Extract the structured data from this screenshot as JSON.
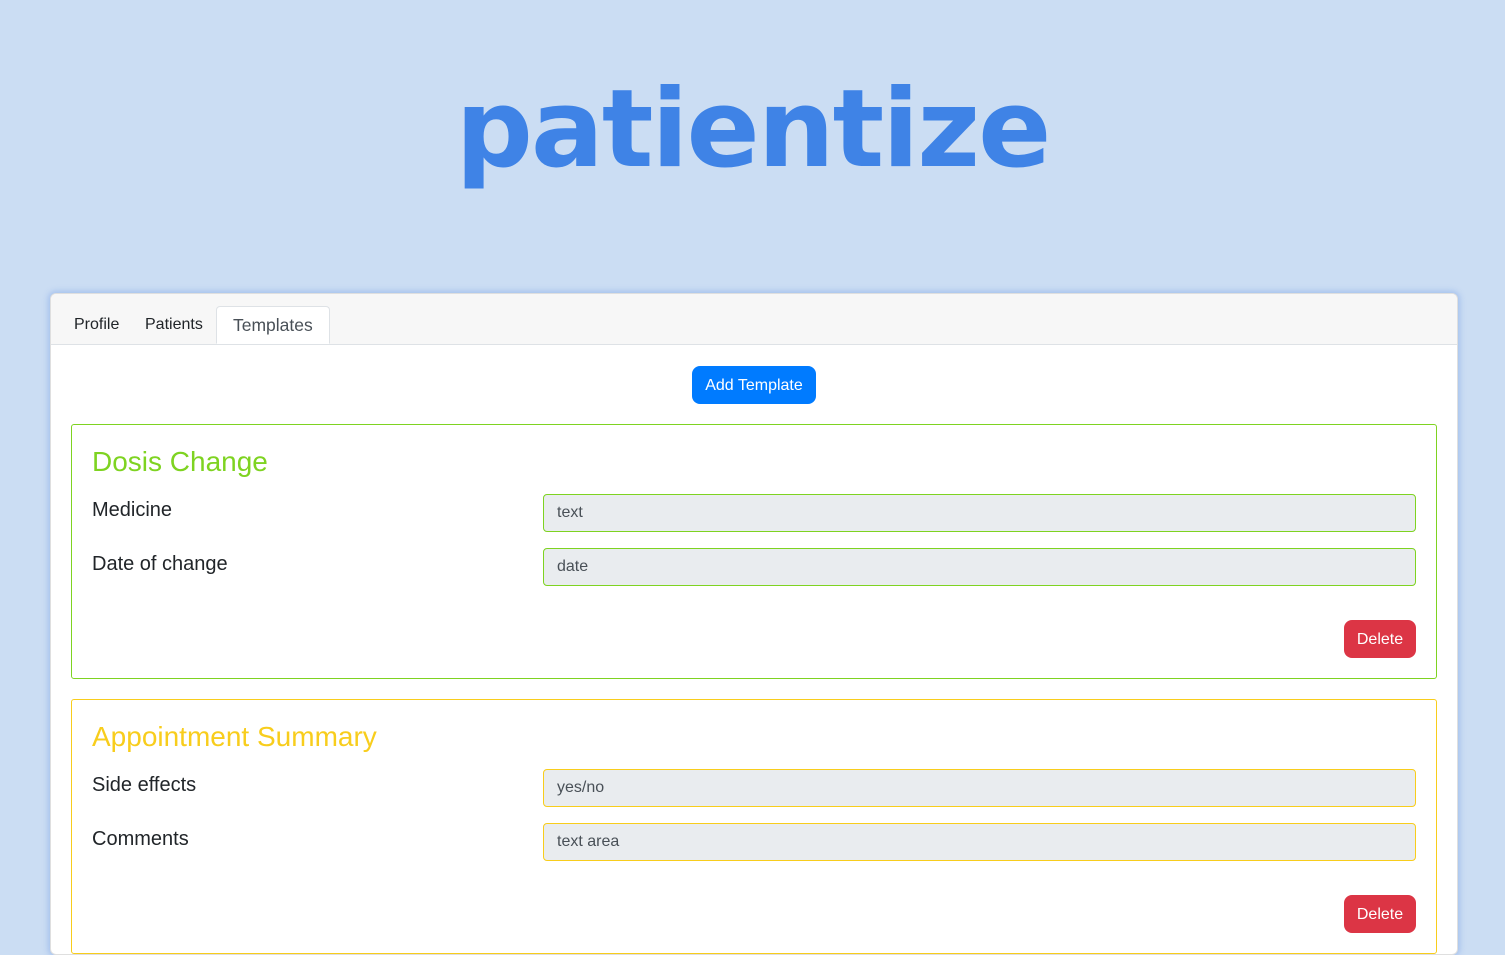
{
  "brand": {
    "logo_text": "patientize",
    "logo_color": "#3f83e6"
  },
  "tabs": [
    {
      "label": "Profile",
      "active": false
    },
    {
      "label": "Patients",
      "active": false
    },
    {
      "label": "Templates",
      "active": true
    }
  ],
  "actions": {
    "add_template_label": "Add Template",
    "add_template_color": "#007bff"
  },
  "templates": [
    {
      "title": "Dosis Change",
      "accent_color": "#7ed321",
      "fields": [
        {
          "label": "Medicine",
          "value": "text"
        },
        {
          "label": "Date of change",
          "value": "date"
        }
      ],
      "delete_label": "Delete"
    },
    {
      "title": "Appointment Summary",
      "accent_color": "#f8cd1c",
      "fields": [
        {
          "label": "Side effects",
          "value": "yes/no"
        },
        {
          "label": "Comments",
          "value": "text area"
        }
      ],
      "delete_label": "Delete"
    }
  ],
  "colors": {
    "page_background": "#cbddf3",
    "delete_button": "#dc3545"
  }
}
